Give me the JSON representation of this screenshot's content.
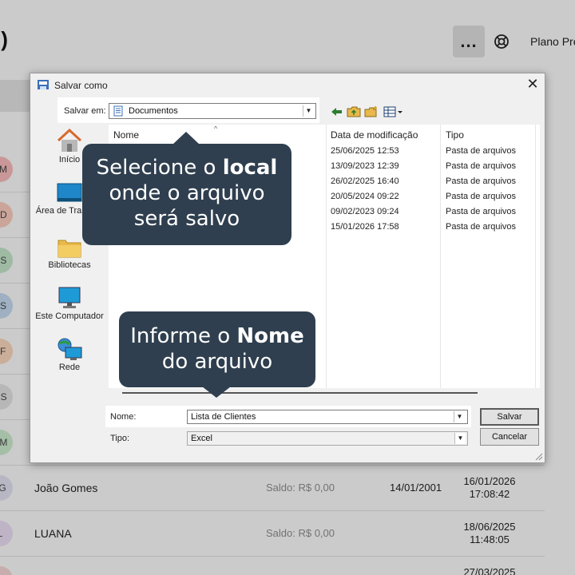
{
  "app": {
    "title_fragment": "l)",
    "more_label": "...",
    "plan_label": "Plano Pre",
    "rows": [
      {
        "initials": "BM",
        "color": "#f2b6b6",
        "name": "",
        "saldo": "",
        "birth": "",
        "date": "",
        "time": ""
      },
      {
        "initials": "CD",
        "color": "#f4c7b8",
        "name": "",
        "saldo": "",
        "birth": "",
        "date": "",
        "time": ""
      },
      {
        "initials": "CS",
        "color": "#bfe0c4",
        "name": "",
        "saldo": "",
        "birth": "",
        "date": "",
        "time": ""
      },
      {
        "initials": "ES",
        "color": "#bfd4e8",
        "name": "",
        "saldo": "",
        "birth": "",
        "date": "",
        "time": ""
      },
      {
        "initials": "FF",
        "color": "#f3d2b9",
        "name": "",
        "saldo": "",
        "birth": "",
        "date": "",
        "time": ""
      },
      {
        "initials": "GS",
        "color": "#dcdcdc",
        "name": "",
        "saldo": "",
        "birth": "",
        "date": "",
        "time": ""
      },
      {
        "initials": "HM",
        "color": "#c7e6c9",
        "name": "",
        "saldo": "",
        "birth": "",
        "date": "",
        "time": ""
      },
      {
        "initials": "JG",
        "color": "#dcdcec",
        "name": "João Gomes",
        "saldo": "Saldo: R$ 0,00",
        "birth": "14/01/2001",
        "date": "16/01/2026",
        "time": "17:08:42"
      },
      {
        "initials": "L",
        "color": "#e6d9ee",
        "name": "LUANA",
        "saldo": "Saldo: R$ 0,00",
        "birth": "",
        "date": "18/06/2025",
        "time": "11:48:05"
      },
      {
        "initials": "",
        "color": "#f0d0d0",
        "name": "",
        "saldo": "",
        "birth": "",
        "date": "27/03/2025",
        "time": ""
      }
    ]
  },
  "dialog": {
    "title": "Salvar como",
    "close_label": "✕",
    "save_in_label": "Salvar em:",
    "save_in_value": "Documentos",
    "places": [
      {
        "label": "Início",
        "icon": "home-icon"
      },
      {
        "label": "Área de Trabalho",
        "icon": "desktop-icon"
      },
      {
        "label": "Bibliotecas",
        "icon": "folder-icon"
      },
      {
        "label": "Este Computador",
        "icon": "computer-icon"
      },
      {
        "label": "Rede",
        "icon": "network-icon"
      }
    ],
    "columns": {
      "name": "Nome",
      "modified": "Data de modificação",
      "type": "Tipo"
    },
    "files": [
      {
        "modified": "25/06/2025 12:53",
        "type": "Pasta de arquivos"
      },
      {
        "modified": "13/09/2023 12:39",
        "type": "Pasta de arquivos"
      },
      {
        "modified": "26/02/2025 16:40",
        "type": "Pasta de arquivos"
      },
      {
        "modified": "20/05/2024 09:22",
        "type": "Pasta de arquivos"
      },
      {
        "modified": "09/02/2023 09:24",
        "type": "Pasta de arquivos"
      },
      {
        "modified": "15/01/2026 17:58",
        "type": "Pasta de arquivos"
      }
    ],
    "name_label": "Nome:",
    "name_value": "Lista de Clientes",
    "type_label": "Tipo:",
    "type_value": "Excel",
    "save_button": "Salvar",
    "cancel_button": "Cancelar"
  },
  "tooltips": {
    "location": {
      "pre": "Selecione o ",
      "bold": "local",
      "line2": "onde o arquivo",
      "line3": "será salvo"
    },
    "name": {
      "pre": "Informe o ",
      "bold": "Nome",
      "line2": "do arquivo"
    }
  },
  "colors": {
    "tooltip_bg": "#2f3f4f",
    "dialog_bg": "#f0f0f0",
    "app_bg": "#f4f4f4"
  }
}
